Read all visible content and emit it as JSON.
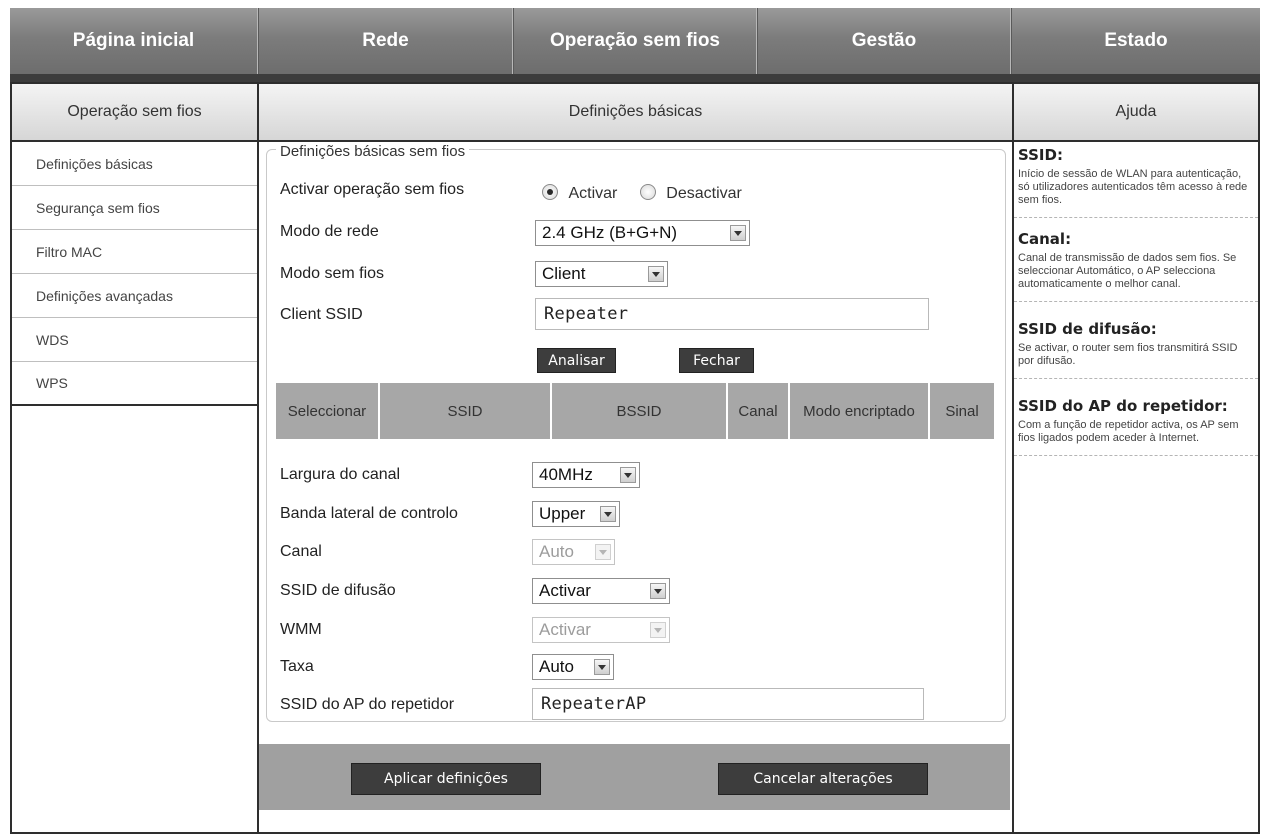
{
  "topnav": {
    "tabs": [
      "Página inicial",
      "Rede",
      "Operação sem fios",
      "Gestão",
      "Estado"
    ]
  },
  "sidebar": {
    "title": "Operação sem fios",
    "items": [
      "Definições básicas",
      "Segurança sem fios",
      "Filtro MAC",
      "Definições avançadas",
      "WDS",
      "WPS"
    ]
  },
  "main": {
    "title": "Definições básicas",
    "legend": "Definições básicas sem fios",
    "labels": {
      "enable": "Activar operação sem fios",
      "network_mode": "Modo de rede",
      "wireless_mode": "Modo sem fios",
      "client_ssid": "Client SSID",
      "channel_width": "Largura do canal",
      "sideband": "Banda lateral de controlo",
      "channel": "Canal",
      "ssid_broadcast": "SSID de difusão",
      "wmm": "WMM",
      "rate": "Taxa",
      "repeater_ssid": "SSID do AP do repetidor"
    },
    "radio": {
      "on": "Activar",
      "off": "Desactivar"
    },
    "values": {
      "network_mode": "2.4 GHz (B+G+N)",
      "wireless_mode": "Client",
      "client_ssid": "Repeater",
      "channel_width": "40MHz",
      "sideband": "Upper",
      "channel": "Auto",
      "ssid_broadcast": "Activar",
      "wmm": "Activar",
      "rate": "Auto",
      "repeater_ssid": "RepeaterAP"
    },
    "buttons": {
      "scan": "Analisar",
      "close": "Fechar"
    },
    "scan_headers": [
      "Seleccionar",
      "SSID",
      "BSSID",
      "Canal",
      "Modo encriptado",
      "Sinal"
    ],
    "footer": {
      "apply": "Aplicar definições",
      "cancel": "Cancelar alterações"
    }
  },
  "help": {
    "title": "Ajuda",
    "sections": [
      {
        "title": "SSID:",
        "text": "Início de sessão de WLAN para autenticação, só utilizadores autenticados têm acesso à rede sem fios."
      },
      {
        "title": "Canal:",
        "text": "Canal de transmissão de dados sem fios. Se seleccionar Automático, o AP selecciona automaticamente o melhor canal."
      },
      {
        "title": "SSID de difusão:",
        "text": "Se activar, o router sem fios transmitirá SSID por difusão."
      },
      {
        "title": "SSID do AP do repetidor:",
        "text": "Com a função de repetidor activa, os AP sem fios ligados podem aceder à Internet."
      }
    ]
  }
}
